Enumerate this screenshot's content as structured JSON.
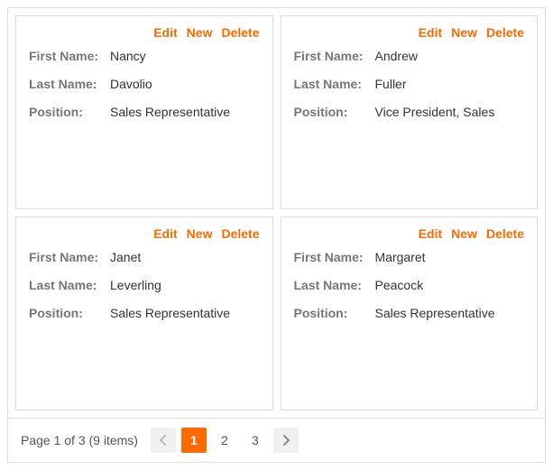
{
  "labels": {
    "edit": "Edit",
    "new": "New",
    "delete": "Delete",
    "firstName": "First Name:",
    "lastName": "Last Name:",
    "position": "Position:"
  },
  "cards": [
    {
      "firstName": "Nancy",
      "lastName": "Davolio",
      "position": "Sales Representative"
    },
    {
      "firstName": "Andrew",
      "lastName": "Fuller",
      "position": "Vice President, Sales"
    },
    {
      "firstName": "Janet",
      "lastName": "Leverling",
      "position": "Sales Representative"
    },
    {
      "firstName": "Margaret",
      "lastName": "Peacock",
      "position": "Sales Representative"
    }
  ],
  "pager": {
    "text": "Page 1 of 3 (9 items)",
    "currentPage": 1,
    "pages": [
      1,
      2,
      3
    ]
  }
}
